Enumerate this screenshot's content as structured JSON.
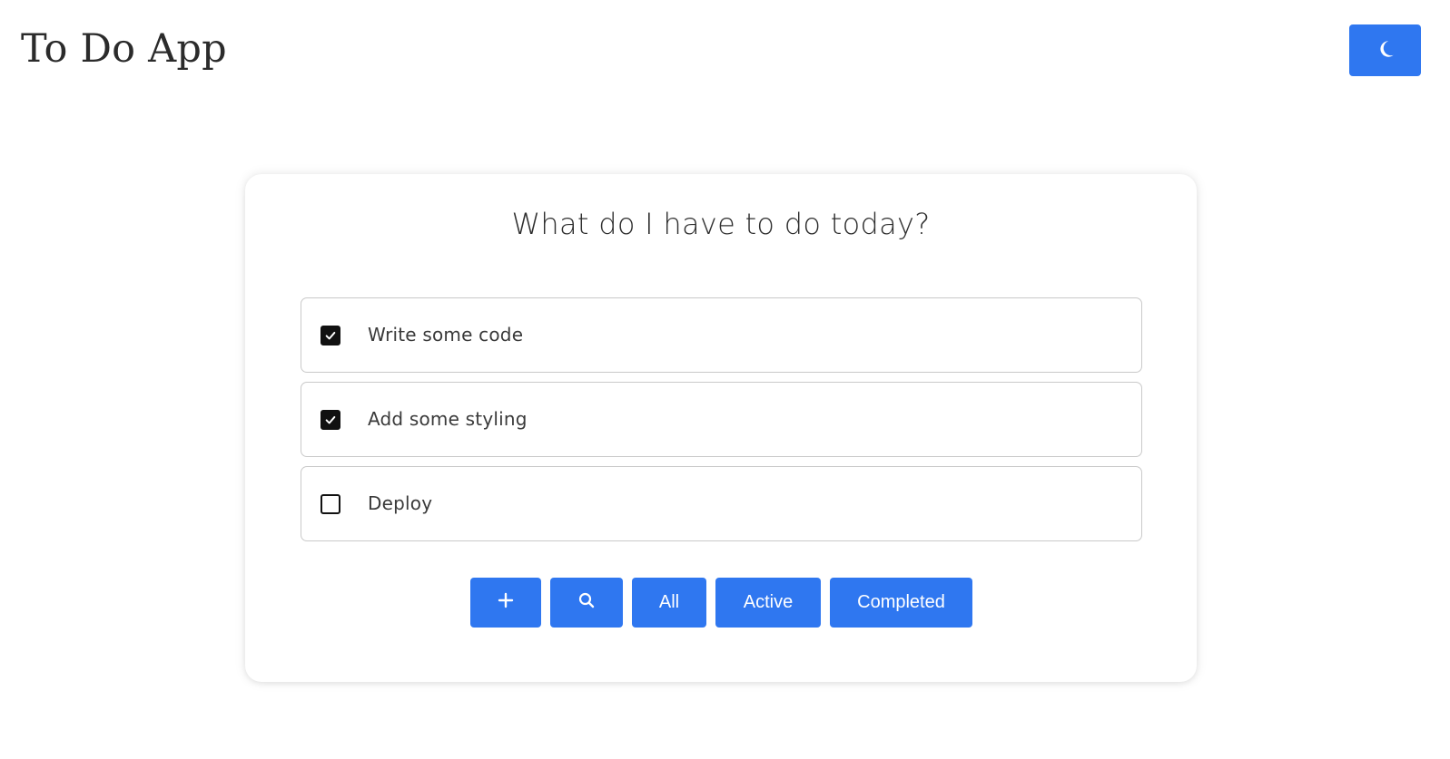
{
  "header": {
    "app_title": "To Do App",
    "theme_toggle_icon": "moon-icon"
  },
  "main": {
    "heading": "What do I have to do today?",
    "todos": [
      {
        "label": "Write some code",
        "completed": true
      },
      {
        "label": "Add some styling",
        "completed": true
      },
      {
        "label": "Deploy",
        "completed": false
      }
    ],
    "actions": {
      "add_icon": "plus-icon",
      "search_icon": "search-icon",
      "all_label": "All",
      "active_label": "Active",
      "completed_label": "Completed"
    }
  },
  "colors": {
    "accent": "#2f77f0",
    "text": "#2f2f2f",
    "checkbox": "#111111"
  }
}
